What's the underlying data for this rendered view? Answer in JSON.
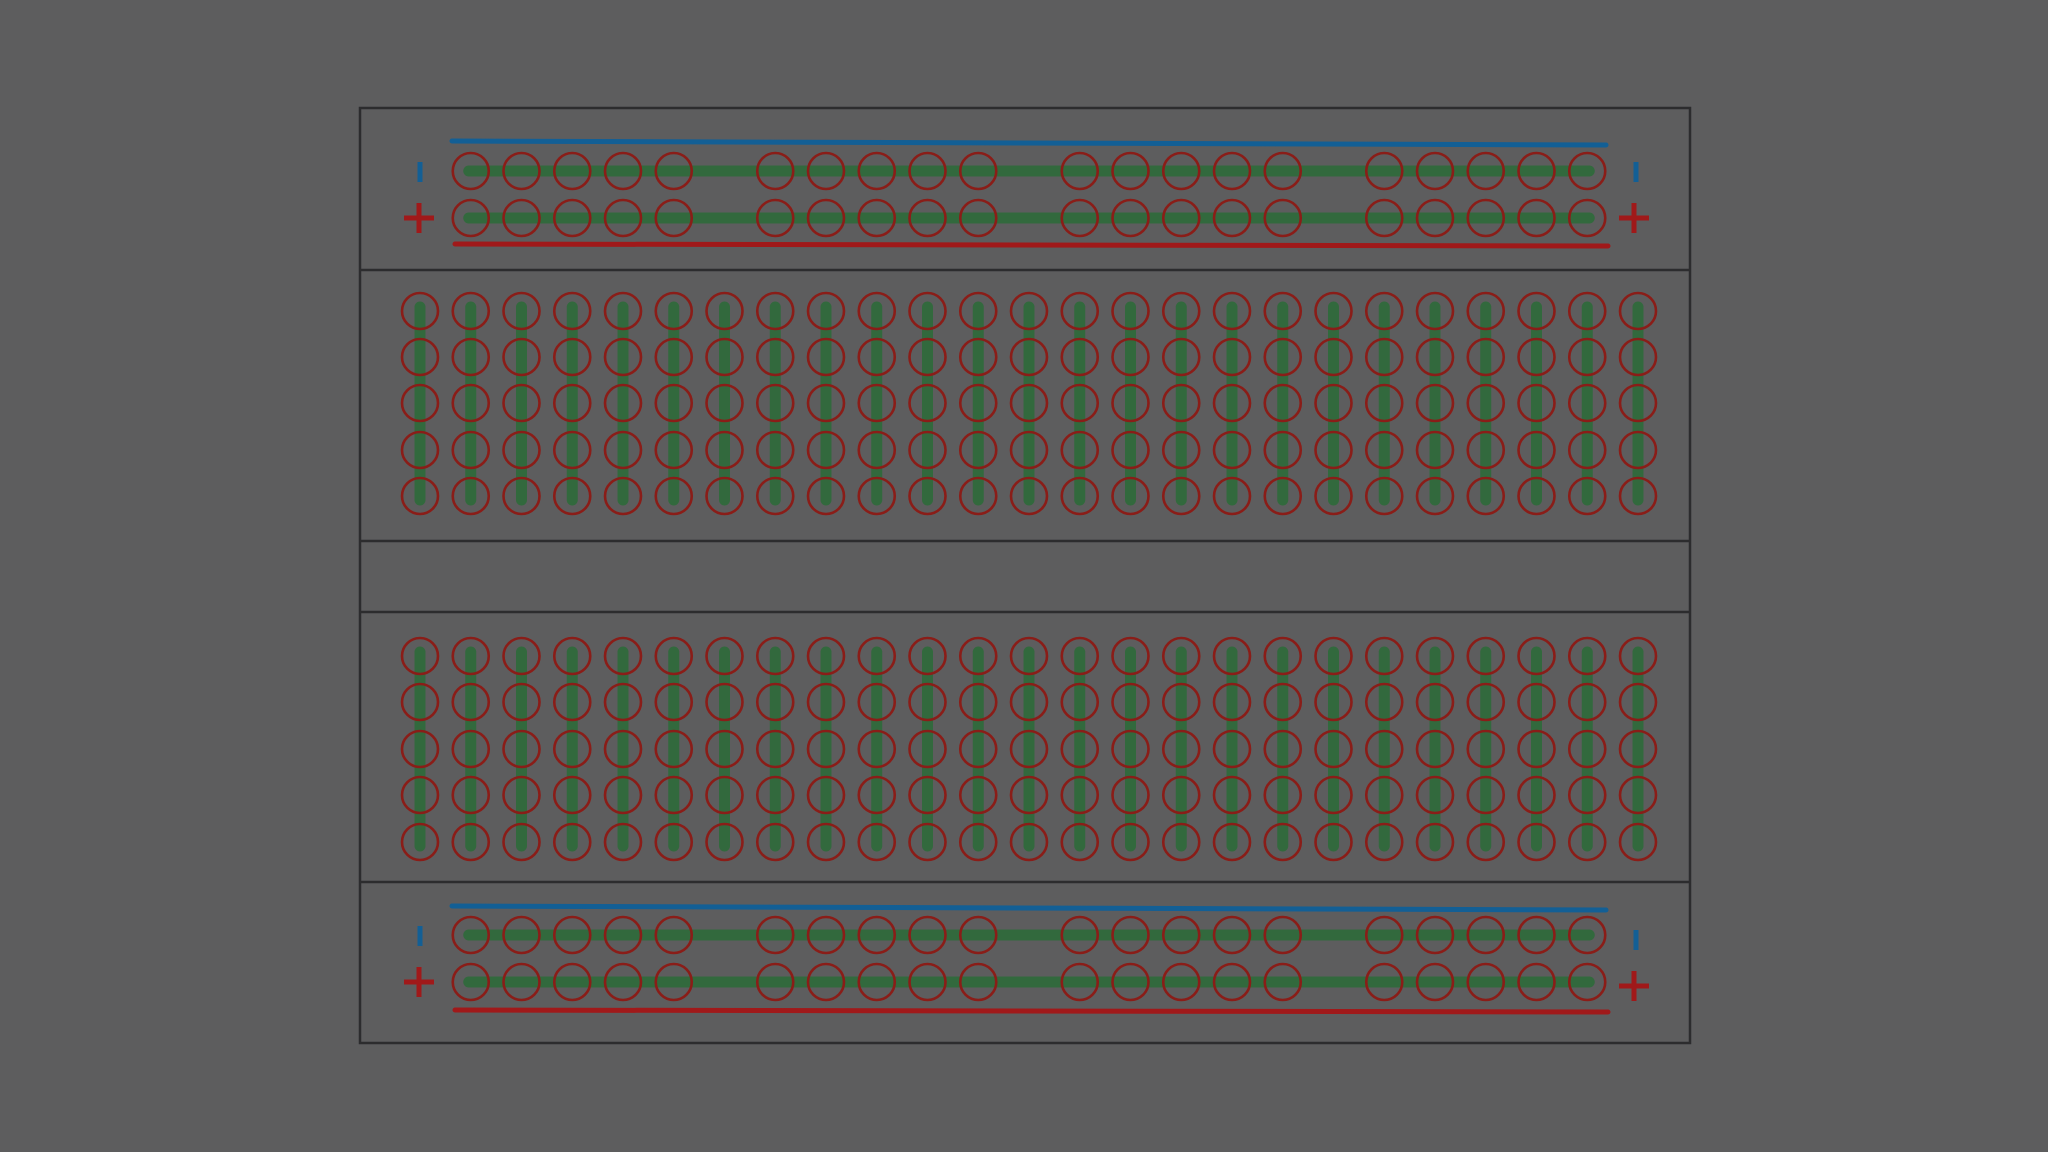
{
  "board": {
    "columns": 25,
    "rows_per_block": 5,
    "power_rail_groups": 4,
    "holes_per_rail_group": 5
  },
  "rails": {
    "negative_symbol": "-",
    "positive_symbol": "+"
  },
  "colors": {
    "background": "#5d5d5e",
    "board_outline": "#2c2c2e",
    "hole": "#8a1d18",
    "connection_strip": "#2e6b3a",
    "negative_rail": "#135f95",
    "positive_rail": "#a0191a"
  }
}
